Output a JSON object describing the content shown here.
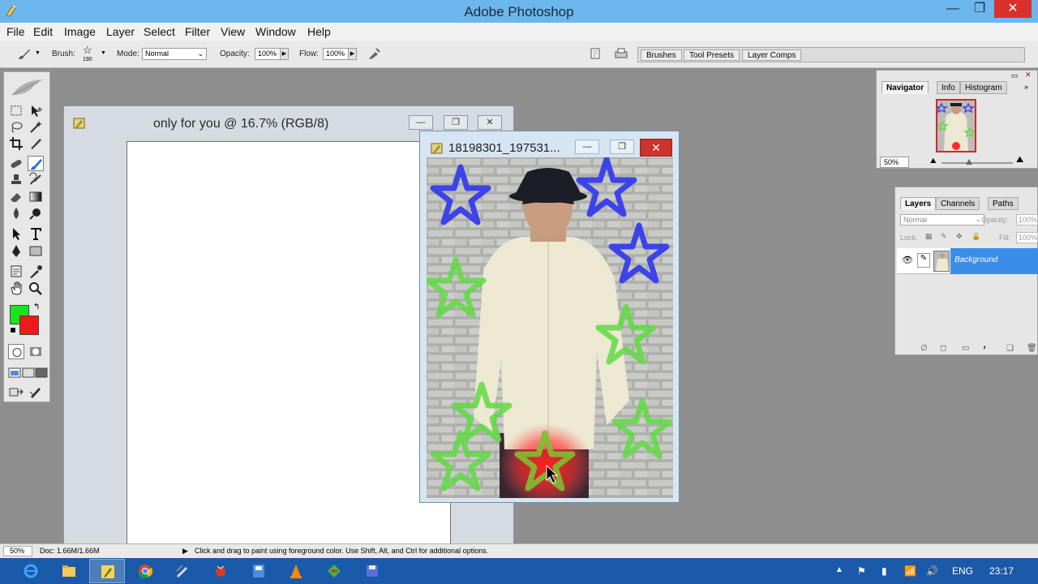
{
  "window": {
    "title": "Adobe Photoshop",
    "controls": {
      "minimize": "—",
      "maximize": "❐",
      "close": "✕"
    }
  },
  "menu": [
    "File",
    "Edit",
    "Image",
    "Layer",
    "Select",
    "Filter",
    "View",
    "Window",
    "Help"
  ],
  "options_bar": {
    "brush_label": "Brush:",
    "brush_size": "190",
    "mode_label": "Mode:",
    "mode_value": "Normal",
    "opacity_label": "Opacity:",
    "opacity_value": "100%",
    "flow_label": "Flow:",
    "flow_value": "100%"
  },
  "palette_well": [
    "Brushes",
    "Tool Presets",
    "Layer Comps"
  ],
  "toolbox": {
    "foreground_color": "#19e519",
    "background_color": "#ee1a1a"
  },
  "document1": {
    "title": "only for you @ 16.7% (RGB/8)"
  },
  "document2": {
    "title": "18198301_197531..."
  },
  "navigator": {
    "tabs": [
      "Navigator",
      "Info",
      "Histogram"
    ],
    "zoom": "50%"
  },
  "layers": {
    "tabs": [
      "Layers",
      "Channels",
      "Paths"
    ],
    "blend_mode": "Normal",
    "opacity_label": "Opacity:",
    "opacity_value": "100%",
    "lock_label": "Lock:",
    "fill_label": "Fill:",
    "fill_value": "100%",
    "items": [
      {
        "name": "Background"
      }
    ]
  },
  "status_bar": {
    "zoom": "50%",
    "doc_info": "Doc: 1.66M/1.66M",
    "hint": "Click and drag to paint using foreground color.  Use Shift, Alt, and Ctrl for additional options."
  },
  "taskbar": {
    "language": "ENG",
    "time": "23:17"
  }
}
